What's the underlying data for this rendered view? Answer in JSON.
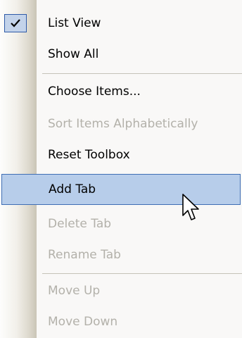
{
  "context_menu": {
    "items": [
      {
        "label": "List View",
        "checked": true,
        "enabled": true
      },
      {
        "label": "Show All",
        "enabled": true
      },
      {
        "label": "Choose Items...",
        "enabled": true
      },
      {
        "label": "Sort Items Alphabetically",
        "enabled": false
      },
      {
        "label": "Reset Toolbox",
        "enabled": true
      },
      {
        "label": "Add Tab",
        "enabled": true,
        "highlighted": true
      },
      {
        "label": "Delete Tab",
        "enabled": false
      },
      {
        "label": "Rename Tab",
        "enabled": false
      },
      {
        "label": "Move Up",
        "enabled": false
      },
      {
        "label": "Move Down",
        "enabled": false
      }
    ]
  },
  "colors": {
    "highlight_fill": "#b7cdea",
    "highlight_border": "#3f6eb4",
    "disabled_text": "#b3b1aa"
  },
  "icons": {
    "check": "checkmark-icon",
    "cursor": "mouse-pointer-icon"
  }
}
